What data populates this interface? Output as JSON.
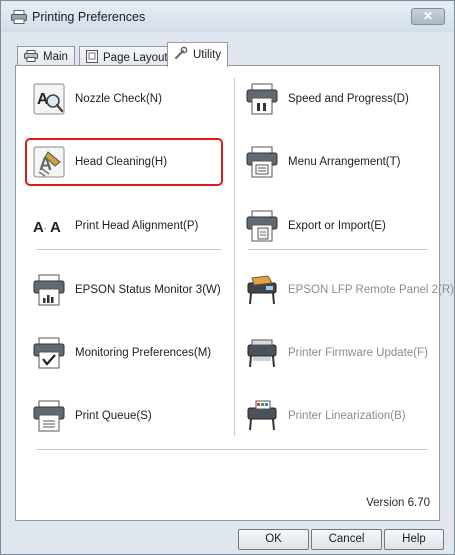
{
  "window": {
    "title": "Printing Preferences",
    "close_symbol": "✕"
  },
  "tabs": [
    {
      "label": "Main",
      "icon": "printer-icon"
    },
    {
      "label": "Page Layout",
      "icon": "page-layout-icon"
    },
    {
      "label": "Utility",
      "icon": "wrench-icon",
      "active": true
    }
  ],
  "left_items": [
    {
      "label": "Nozzle Check(N)",
      "icon": "nozzle-check-icon"
    },
    {
      "label": "Head Cleaning(H)",
      "icon": "head-cleaning-icon"
    },
    {
      "label": "Print Head Alignment(P)",
      "icon": "head-alignment-icon"
    },
    {
      "label": "EPSON Status Monitor 3(W)",
      "icon": "status-monitor-icon"
    },
    {
      "label": "Monitoring Preferences(M)",
      "icon": "monitoring-preferences-icon"
    },
    {
      "label": "Print Queue(S)",
      "icon": "print-queue-icon"
    }
  ],
  "right_items": [
    {
      "label": "Speed and Progress(D)",
      "icon": "speed-progress-icon"
    },
    {
      "label": "Menu Arrangement(T)",
      "icon": "menu-arrangement-icon"
    },
    {
      "label": "Export or Import(E)",
      "icon": "export-import-icon"
    },
    {
      "label": "EPSON LFP Remote Panel 2(R)",
      "icon": "remote-panel-icon",
      "disabled": true
    },
    {
      "label": "Printer Firmware Update(F)",
      "icon": "firmware-update-icon",
      "disabled": true
    },
    {
      "label": "Printer Linearization(B)",
      "icon": "linearization-icon",
      "disabled": true
    }
  ],
  "version": "Version 6.70",
  "buttons": {
    "ok": "OK",
    "cancel": "Cancel",
    "help": "Help"
  },
  "colors": {
    "highlight": "#e01a1a",
    "accent": "#0066cc"
  }
}
